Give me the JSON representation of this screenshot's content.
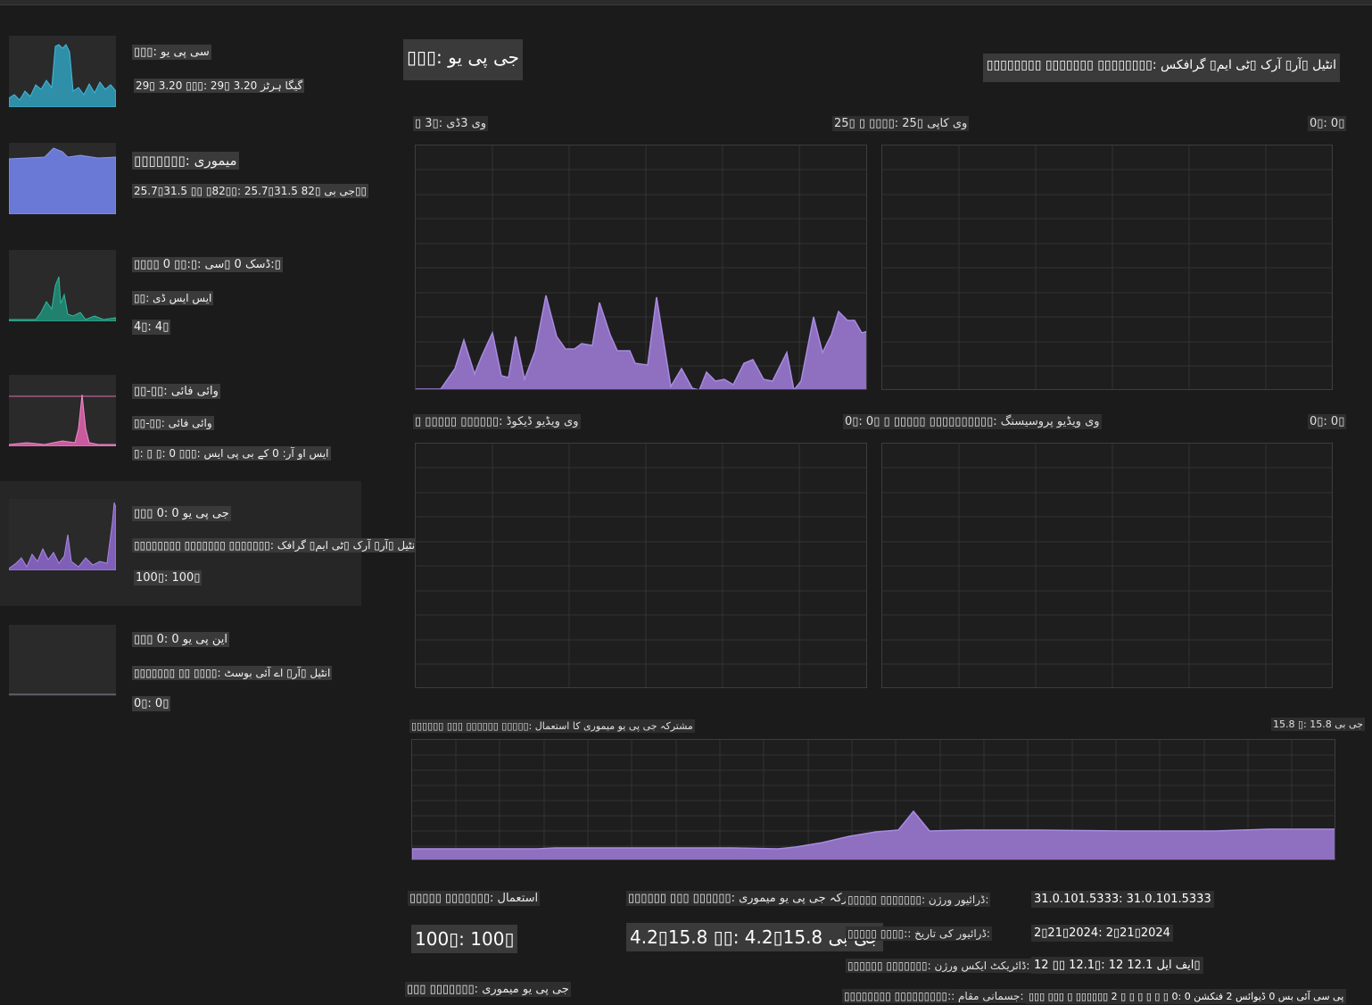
{
  "sidebar": {
    "items": [
      {
        "title": "▯▯▯: سی پی یو",
        "line2": "29▯ 3.20 ▯▯▯: 29▯ 3.20 گیگا ہرٹز",
        "color": "#3aa6c4"
      },
      {
        "title": "▯▯▯▯▯▯▯: میموری",
        "line2": "25.7▯31.5 ▯▯ ▯82▯▯: 25.7▯31.5 جی بی ▯82▯▯",
        "color": "#6a78d6"
      },
      {
        "title": "▯▯▯▯ 0 ▯▯:▯: ڈسک 0 ▯سی:▯",
        "line2": "▯▯: ایس ایس ڈی",
        "line3": "4▯: 4▯",
        "color": "#2aa58e"
      },
      {
        "title": "▯▯-▯▯: وائی فائی",
        "line2": "▯▯-▯▯: وائی فائی",
        "line3": "▯: ▯ ▯: 0 ▯▯▯: ایس او آر: 0 کے بی پی ایس",
        "color": "#e06fb0"
      },
      {
        "title": "▯▯▯ 0: جی پی یو 0",
        "line2": "▯▯▯▯▯▯▯▯ ▯▯▯▯▯▯▯ ▯▯▯▯▯▯▯: انٹیل ▯آر▯ آرک ▯ٹی ایم▯ گرافک",
        "line3": "100▯: 100▯",
        "color": "#9a7ad0"
      },
      {
        "title": "▯▯▯ 0: این پی یو 0",
        "line2": "▯▯▯▯▯▯▯ ▯▯ ▯▯▯▯: انٹیل ▯آر▯ اے آئی بوسٹ",
        "line3": "0▯: 0▯",
        "color": "#8a8aa0"
      }
    ]
  },
  "header": {
    "title": "▯▯▯: جی پی یو",
    "model": "▯▯▯▯▯▯▯▯ ▯▯▯▯▯▯▯ ▯▯▯▯▯▯▯▯: انٹیل ▯آر▯ آرک ▯ٹی ایم▯ گرافکس"
  },
  "graphs": {
    "g1_label": "▯ 3▯: وی 3ڈی",
    "g1_pct": "25▯ ▯ ▯▯▯▯: 25▯ وی کاپی",
    "g1_right": "0▯: 0▯",
    "g2_label": "▯ ▯▯▯▯▯ ▯▯▯▯▯▯: وی ویڈیو ڈیکوڈ",
    "g2_pct": "0▯: 0▯ ▯ ▯▯▯▯▯ ▯▯▯▯▯▯▯▯▯▯: وی ویڈیو پروسیسنگ",
    "g2_right": "0▯: 0▯",
    "shared_label": "▯▯▯▯▯▯ ▯▯▯ ▯▯▯▯▯▯ ▯▯▯▯▯: مشترکہ جی پی یو میموری کا استعمال",
    "shared_max": "15.8 ▯: 15.8 جی بی"
  },
  "stats": {
    "util_label": "▯▯▯▯▯ ▯▯▯▯▯▯▯: استعمال",
    "util_value": "100▯: 100▯",
    "shared_label": "▯▯▯▯▯▯ ▯▯▯ ▯▯▯▯▯▯: مشترکہ جی پی یو میموری",
    "shared_value": "4.2▯15.8 ▯▯: 4.2▯15.8 جی بی",
    "gpu_mem_label": "▯▯▯ ▯▯▯▯▯▯▯: جی پی یو میموری"
  },
  "details": {
    "driver_version_key": "▯▯▯▯▯ ▯▯▯▯▯▯▯: ڈرائیور ورژن:",
    "driver_version_val": "31.0.101.5333: 31.0.101.5333",
    "driver_date_key": "▯▯▯▯▯ ▯▯▯▯:: ڈرائیور کی تاریخ:",
    "driver_date_val": "2▯21▯2024: 2▯21▯2024",
    "directx_key": "▯▯▯▯▯▯ ▯▯▯▯▯▯▯: ڈائریکٹ ایکس ورژن:",
    "directx_val": "12 ▯▯ 12.1▯: 12 ایف ایل 12.1▯",
    "location_key": "▯▯▯▯▯▯▯▯ ▯▯▯▯▯▯▯▯▯:: جسمانی مقام:",
    "location_val": "▯▯▯ ▯▯▯ ▯ ▯▯▯▯▯▯ 2 ▯ ▯ ▯ ▯ ▯ ▯ 0: پی سی آئی بس 0 ڈیوائس 2 فنکشن 0"
  },
  "colors": {
    "gpu_purple": "#8e6fc0",
    "bg": "#1b1b1b",
    "grid": "#333333"
  }
}
